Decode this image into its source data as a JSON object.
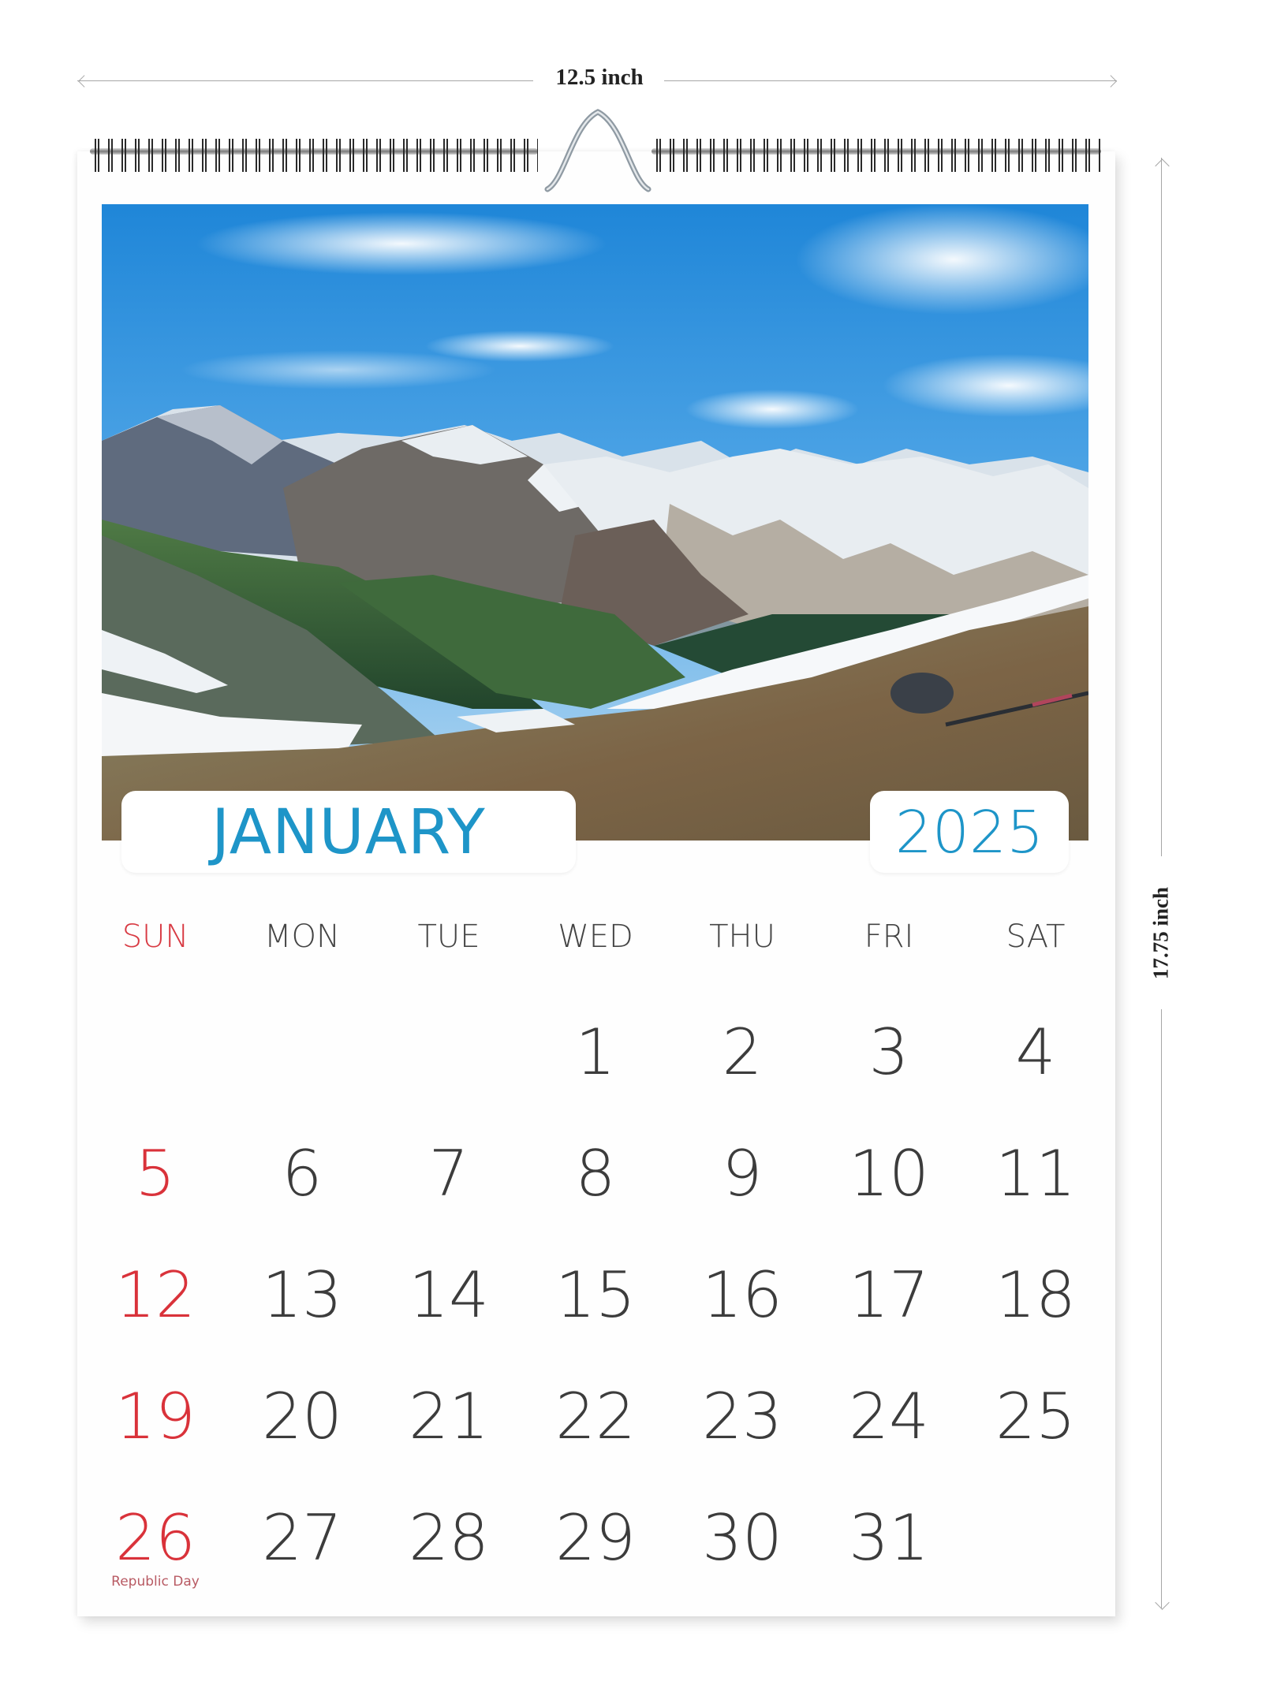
{
  "dimensions": {
    "width_label": "12.5 inch",
    "height_label": "17.75 inch"
  },
  "calendar": {
    "month": "JANUARY",
    "year": "2025",
    "accent_color": "#1e95c8",
    "sunday_color": "#d9323a",
    "text_color": "#3c3c3c",
    "photo_subject": "Snow-capped mountain valley under blue sky",
    "weekdays": [
      "SUN",
      "MON",
      "TUE",
      "WED",
      "THU",
      "FRI",
      "SAT"
    ],
    "weeks": [
      [
        "",
        "",
        "",
        "1",
        "2",
        "3",
        "4"
      ],
      [
        "5",
        "6",
        "7",
        "8",
        "9",
        "10",
        "11"
      ],
      [
        "12",
        "13",
        "14",
        "15",
        "16",
        "17",
        "18"
      ],
      [
        "19",
        "20",
        "21",
        "22",
        "23",
        "24",
        "25"
      ],
      [
        "26",
        "27",
        "28",
        "29",
        "30",
        "31",
        ""
      ]
    ],
    "holidays": [
      {
        "date": "26",
        "label": "Republic Day"
      }
    ]
  }
}
